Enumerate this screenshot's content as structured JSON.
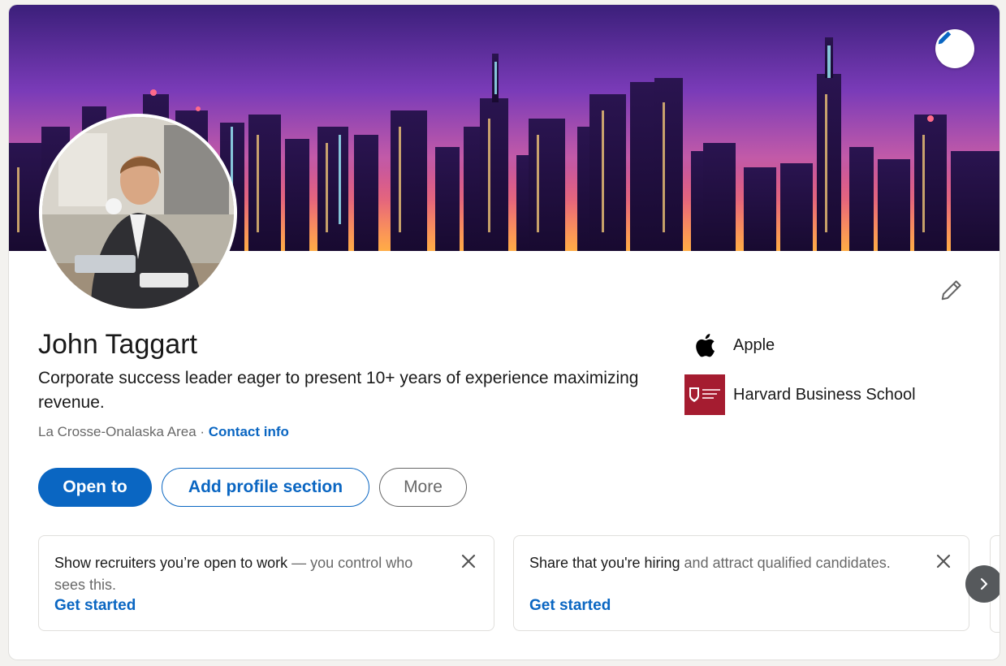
{
  "profile": {
    "name": "John Taggart",
    "headline": "Corporate success leader eager to present 10+ years of experience maximizing revenue.",
    "location": "La Crosse-Onalaska Area",
    "separator": " · ",
    "contact_label": "Contact info"
  },
  "actions": {
    "open_to": "Open to",
    "add_section": "Add profile section",
    "more": "More"
  },
  "experience": [
    {
      "name": "Apple",
      "logo_icon": "apple-logo-icon"
    },
    {
      "name": "Harvard Business School",
      "logo_icon": "harvard-shield-icon"
    }
  ],
  "promos": [
    {
      "text_strong": "Show recruiters you’re open to work",
      "text_rest": " — you control who sees this.",
      "link": "Get started"
    },
    {
      "text_strong": "Share that you're hiring",
      "text_rest": " and attract qualified candidates.",
      "link": "Get started"
    }
  ],
  "icons": {
    "banner_edit": "pencil-icon",
    "intro_edit": "pencil-outline-icon",
    "close": "close-icon",
    "next": "chevron-right-icon"
  },
  "colors": {
    "brand_blue": "#0a66c2",
    "harvard_crimson": "#a51c30",
    "muted_text": "#666666"
  }
}
